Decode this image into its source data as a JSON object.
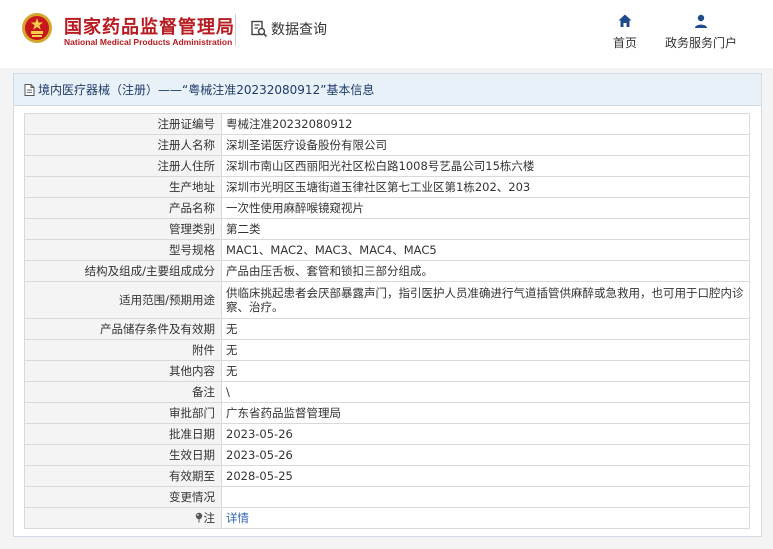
{
  "header": {
    "logo_cn": "国家药品监督管理局",
    "logo_en": "National Medical Products Administration",
    "query_label": "数据查询",
    "nav": [
      {
        "label": "首页",
        "icon": "home-icon"
      },
      {
        "label": "政务服务门户",
        "icon": "user-icon"
      }
    ]
  },
  "panel": {
    "title": "境内医疗器械（注册）——“粤械注准20232080912”基本信息"
  },
  "rows": [
    {
      "key": "注册证编号",
      "value": "粤械注准20232080912"
    },
    {
      "key": "注册人名称",
      "value": "深圳圣诺医疗设备股份有限公司"
    },
    {
      "key": "注册人住所",
      "value": "深圳市南山区西丽阳光社区松白路1008号艺晶公司15栋六楼"
    },
    {
      "key": "生产地址",
      "value": "深圳市光明区玉塘街道玉律社区第七工业区第1栋202、203"
    },
    {
      "key": "产品名称",
      "value": "一次性使用麻醉喉镜窥视片"
    },
    {
      "key": "管理类别",
      "value": "第二类"
    },
    {
      "key": "型号规格",
      "value": "MAC1、MAC2、MAC3、MAC4、MAC5"
    },
    {
      "key": "结构及组成/主要组成成分",
      "value": "产品由压舌板、套管和锁扣三部分组成。"
    },
    {
      "key": "适用范围/预期用途",
      "value": "供临床挑起患者会厌部暴露声门，指引医护人员准确进行气道插管供麻醉或急救用，也可用于口腔内诊察、治疗。"
    },
    {
      "key": "产品储存条件及有效期",
      "value": "无"
    },
    {
      "key": "附件",
      "value": "无"
    },
    {
      "key": "其他内容",
      "value": "无"
    },
    {
      "key": "备注",
      "value": "\\"
    },
    {
      "key": "审批部门",
      "value": "广东省药品监督管理局"
    },
    {
      "key": "批准日期",
      "value": "2023-05-26"
    },
    {
      "key": "生效日期",
      "value": "2023-05-26"
    },
    {
      "key": "有效期至",
      "value": "2028-05-25"
    },
    {
      "key": "变更情况",
      "value": ""
    }
  ],
  "note_row": {
    "key": "注",
    "value": "详情"
  },
  "colors": {
    "brand_red": "#b81b20",
    "title_bg": "#e8f0f8",
    "link": "#2a66b8"
  }
}
